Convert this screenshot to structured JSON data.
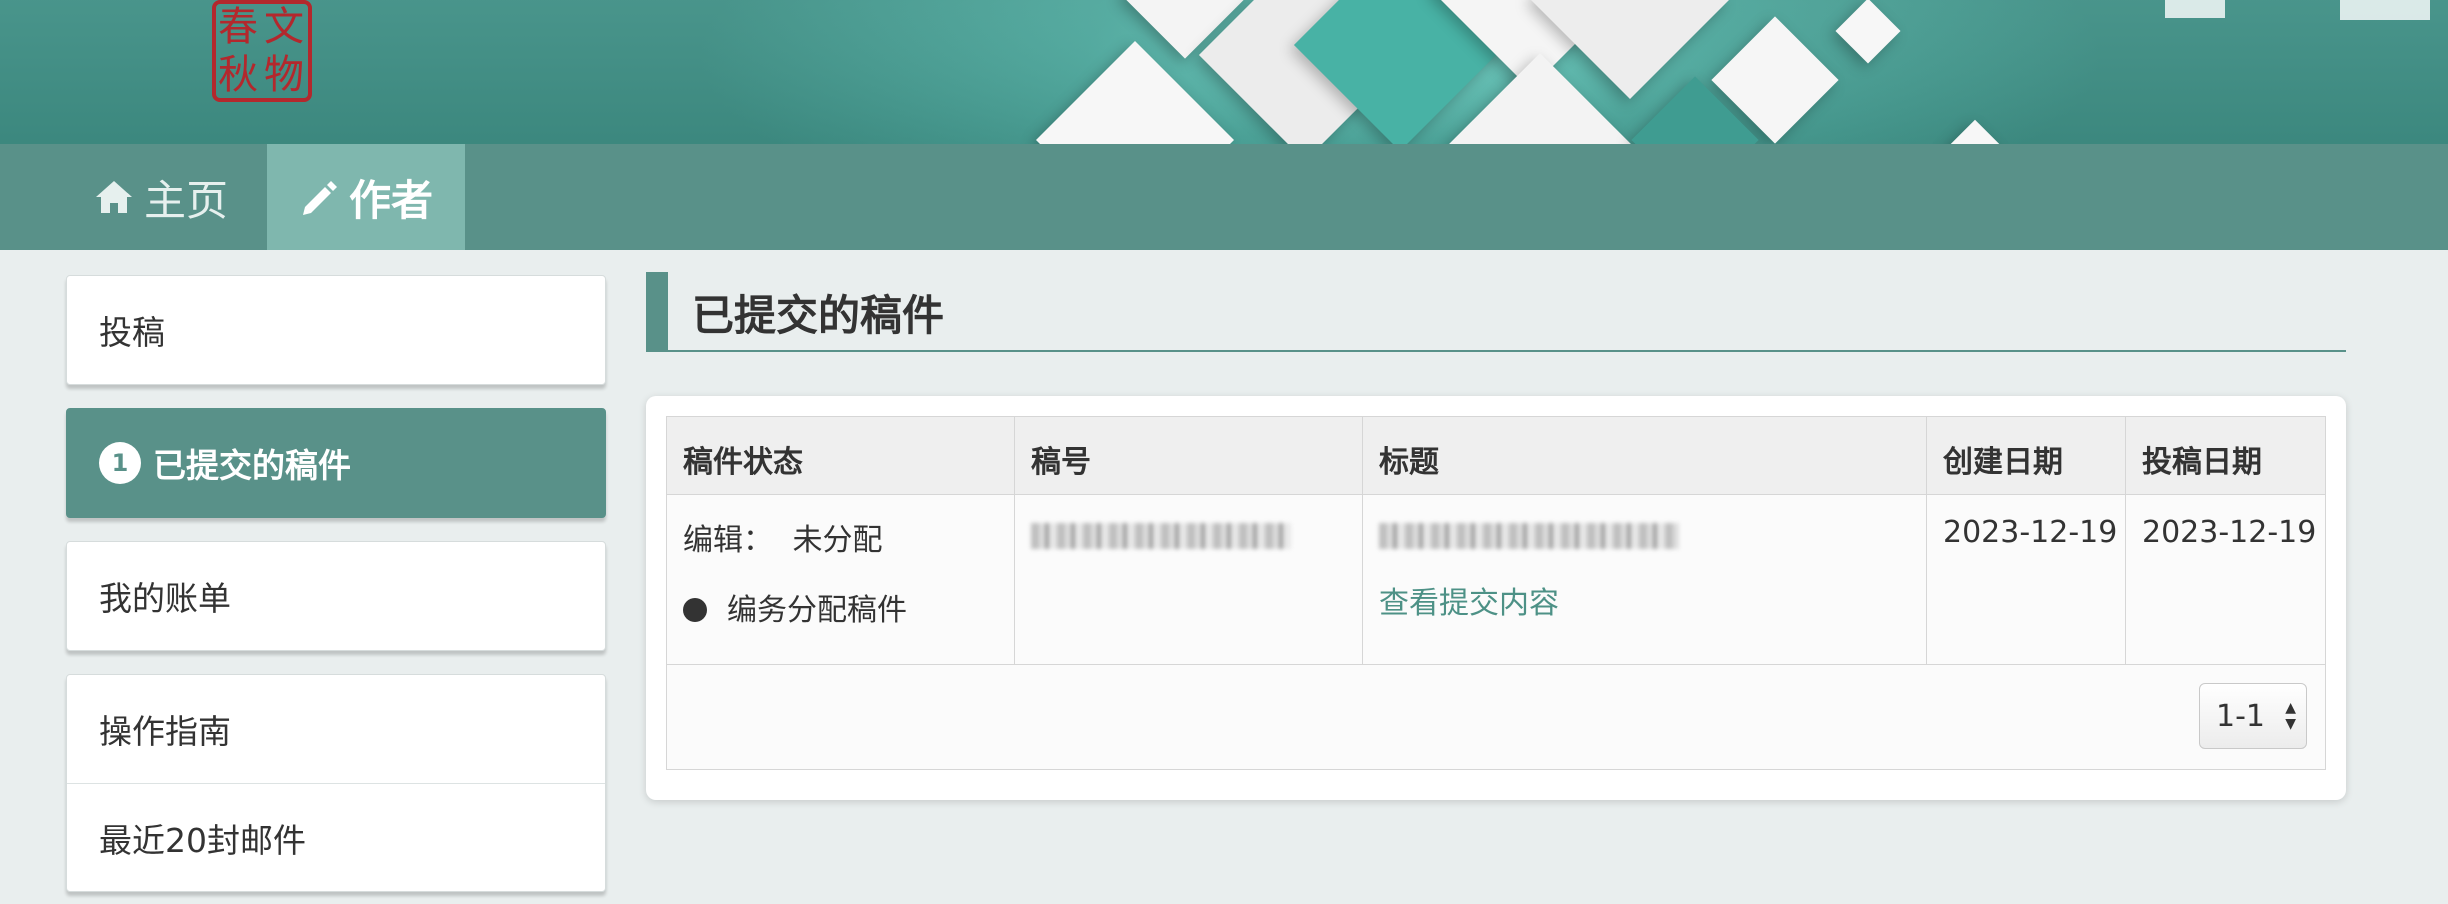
{
  "colors": {
    "brand": "#599189",
    "brand_light": "#7fb7ae",
    "link": "#4d9186"
  },
  "banner": {
    "logo_text_1": "春",
    "logo_text_2": "文",
    "logo_text_3": "秋",
    "logo_text_4": "物"
  },
  "nav": {
    "items": [
      {
        "label": "主页",
        "icon": "home-icon"
      },
      {
        "label": "作者",
        "icon": "pencil-icon"
      }
    ]
  },
  "sidebar": {
    "items": [
      {
        "label": "投稿"
      },
      {
        "label": "已提交的稿件",
        "badge": "1"
      },
      {
        "label": "我的账单"
      },
      {
        "label": "操作指南"
      },
      {
        "label": "最近20封邮件"
      }
    ]
  },
  "main": {
    "title": "已提交的稿件",
    "table": {
      "headers": [
        "稿件状态",
        "稿号",
        "标题",
        "创建日期",
        "投稿日期"
      ],
      "row": {
        "status_label": "编辑：",
        "status_value": "未分配",
        "status_note": "编务分配稿件",
        "title_link": "查看提交内容",
        "created": "2023-12-19",
        "submitted": "2023-12-19"
      },
      "pager": "1-1"
    }
  }
}
